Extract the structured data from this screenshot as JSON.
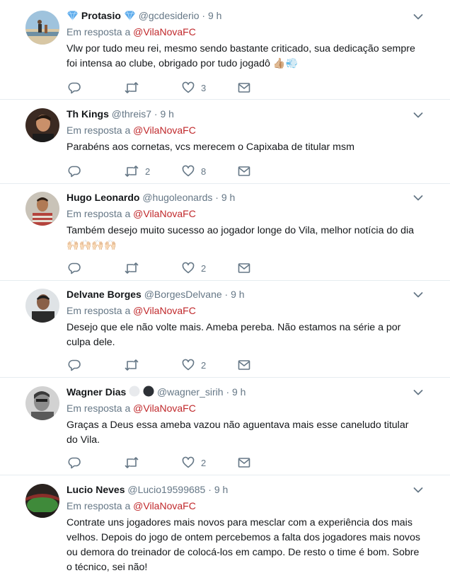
{
  "reply_prefix": "Em resposta a",
  "tweets": [
    {
      "name": "Protasio",
      "handle": "@gcdesiderio",
      "time": "9 h",
      "reply_to": "@VilaNovaFC",
      "text": "Vlw por tudo meu rei, mesmo sendo bastante criticado, sua dedicação sempre foi intensa ao clube, obrigado por tudo jogadô 👍🏼💨",
      "retweets": "",
      "likes": "3",
      "avatar_icon": "avatar-beach-icon"
    },
    {
      "name": "Th Kings",
      "handle": "@threis7",
      "time": "9 h",
      "reply_to": "@VilaNovaFC",
      "text": "Parabéns aos cornetas, vcs merecem o Capixaba de titular msm",
      "retweets": "2",
      "likes": "8",
      "avatar_icon": "avatar-man-icon"
    },
    {
      "name": "Hugo Leonardo",
      "handle": "@hugoleonards",
      "time": "9 h",
      "reply_to": "@VilaNovaFC",
      "text": "Também desejo muito sucesso ao jogador longe do Vila, melhor notícia do dia 🙌🏻🙌🏻🙌🏻🙌🏻",
      "retweets": "",
      "likes": "2",
      "avatar_icon": "avatar-man-icon"
    },
    {
      "name": "Delvane Borges",
      "handle": "@BorgesDelvane",
      "time": "9 h",
      "reply_to": "@VilaNovaFC",
      "text": "Desejo que ele não volte mais. Ameba pereba. Não estamos na série a por culpa dele.",
      "retweets": "",
      "likes": "2",
      "avatar_icon": "avatar-man-icon"
    },
    {
      "name": "Wagner Dias",
      "handle": "@wagner_sirih",
      "time": "9 h",
      "reply_to": "@VilaNovaFC",
      "text": "Graças a Deus essa ameba vazou não aguentava mais esse caneludo titular do Vila.",
      "retweets": "",
      "likes": "2",
      "avatar_icon": "avatar-man-icon"
    },
    {
      "name": "Lucio Neves",
      "handle": "@Lucio19599685",
      "time": "9 h",
      "reply_to": "@VilaNovaFC",
      "text": "Contrate uns jogadores mais novos para mesclar com a experiência dos mais velhos. Depois do jogo de ontem percebemos a falta dos jogadores mais  novos ou demora do treinador de colocá-los  em campo. De resto o time é bom. Sobre o técnico,  sei não!",
      "retweets": "",
      "likes": "",
      "avatar_icon": "avatar-stadium-icon"
    }
  ],
  "colors": {
    "link": "#c0282b",
    "muted": "#657786",
    "text": "#14171a",
    "divider": "#e6ecf0"
  }
}
